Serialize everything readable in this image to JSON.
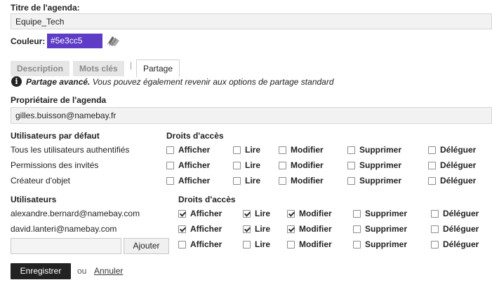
{
  "title_label": "Titre de l'agenda:",
  "title_value": "Equipe_Tech",
  "color_label": "Couleur:",
  "color_value": "#5e3cc5",
  "color_swatch": "#5e3cc5",
  "tabs": [
    {
      "label": "Description"
    },
    {
      "label": "Mots clés"
    },
    {
      "label": "Partage"
    }
  ],
  "tab_separator": "|",
  "info_icon": "info-icon",
  "notice_bold": "Partage avancé.",
  "notice_text": " Vous pouvez également revenir aux options de partage standard",
  "owner_label": "Propriétaire de l'agenda",
  "owner_value": "gilles.buisson@namebay.fr",
  "default_users_header": "Utilisateurs par défaut",
  "rights_header": "Droits d'accès",
  "permissions": [
    "Afficher",
    "Lire",
    "Modifier",
    "Supprimer",
    "Déléguer"
  ],
  "default_rows": [
    {
      "name": "Tous les utilisateurs authentifiés",
      "checked": [
        false,
        false,
        false,
        false,
        false
      ]
    },
    {
      "name": "Permissions des invités",
      "checked": [
        false,
        false,
        false,
        false,
        false
      ]
    },
    {
      "name": "Créateur d'objet",
      "checked": [
        false,
        false,
        false,
        false,
        false
      ]
    }
  ],
  "users_header": "Utilisateurs",
  "user_rows": [
    {
      "name": "alexandre.bernard@namebay.com",
      "checked": [
        true,
        true,
        true,
        false,
        false
      ]
    },
    {
      "name": "david.lanteri@namebay.com",
      "checked": [
        true,
        true,
        true,
        false,
        false
      ]
    }
  ],
  "new_user": {
    "value": "",
    "add_label": "Ajouter",
    "checked": [
      false,
      false,
      false,
      false,
      false
    ]
  },
  "save_label": "Enregistrer",
  "or_text": "ou",
  "cancel_label": "Annuler"
}
